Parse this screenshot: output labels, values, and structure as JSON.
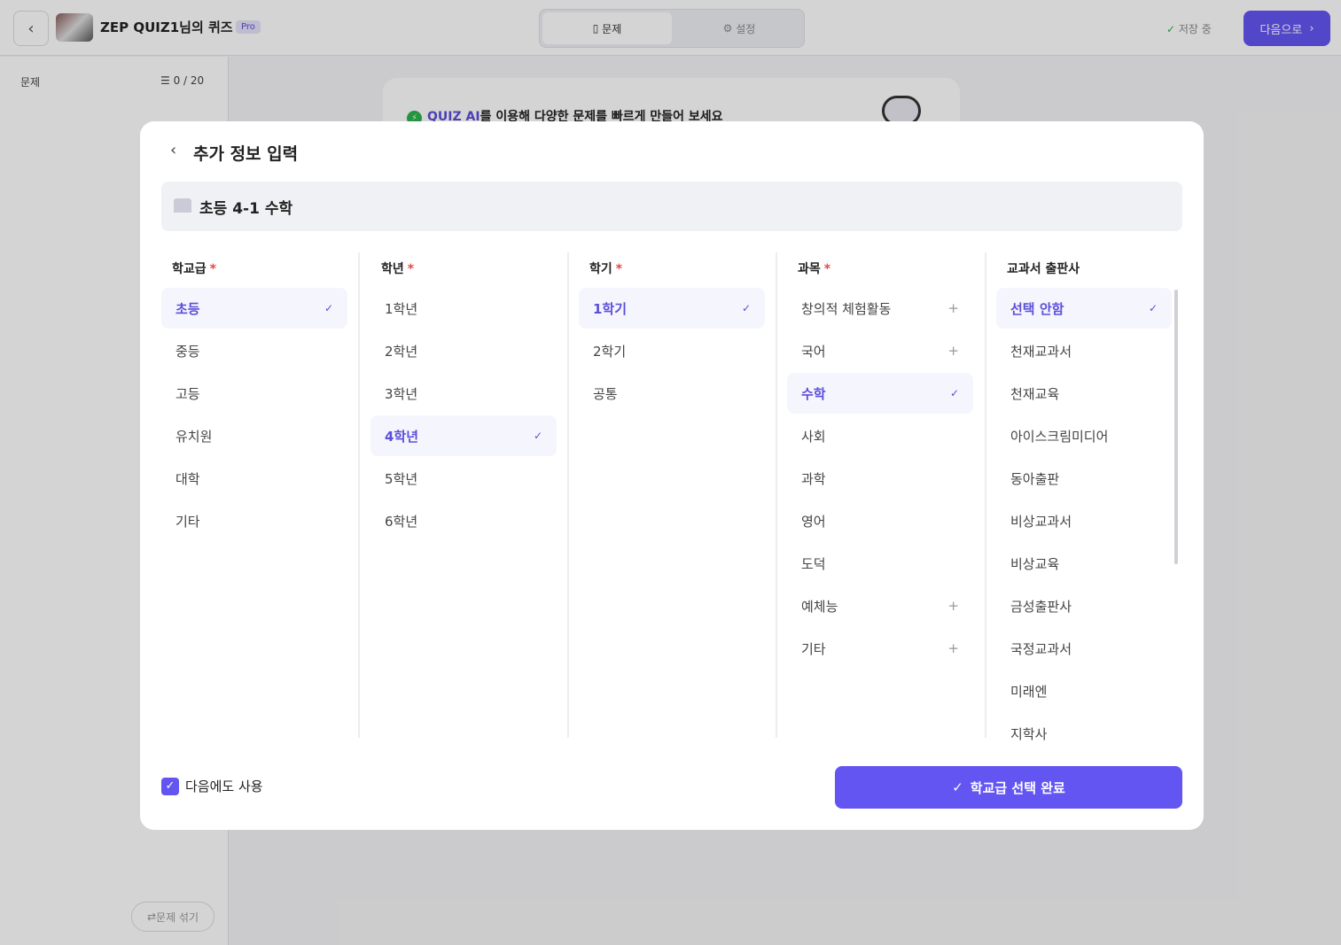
{
  "header": {
    "title": "ZEP QUIZ1님의 퀴즈",
    "badge": "Pro",
    "tabs": [
      {
        "label": "문제",
        "icon": "document-icon"
      },
      {
        "label": "설정",
        "icon": "gear-icon"
      }
    ],
    "status": "저장 중",
    "next": "다음으로"
  },
  "sidebar": {
    "label": "문제",
    "count": "0 / 20",
    "shuffle": "문제 섞기"
  },
  "ai_card": {
    "highlight": "QUIZ AI",
    "text": "를 이용해 다양한 문제를 빠르게 만들어 보세요"
  },
  "modal": {
    "title": "추가 정보 입력",
    "summary": "초등 4-1 수학",
    "remember_label": "다음에도 사용",
    "remember_checked": true,
    "confirm": "학교급 선택 완료",
    "columns": [
      {
        "header": "학교급",
        "required": true,
        "items": [
          {
            "label": "초등",
            "selected": true
          },
          {
            "label": "중등"
          },
          {
            "label": "고등"
          },
          {
            "label": "유치원"
          },
          {
            "label": "대학"
          },
          {
            "label": "기타"
          }
        ]
      },
      {
        "header": "학년",
        "required": true,
        "items": [
          {
            "label": "1학년"
          },
          {
            "label": "2학년"
          },
          {
            "label": "3학년"
          },
          {
            "label": "4학년",
            "selected": true
          },
          {
            "label": "5학년"
          },
          {
            "label": "6학년"
          }
        ]
      },
      {
        "header": "학기",
        "required": true,
        "items": [
          {
            "label": "1학기",
            "selected": true
          },
          {
            "label": "2학기"
          },
          {
            "label": "공통"
          }
        ]
      },
      {
        "header": "과목",
        "required": true,
        "items": [
          {
            "label": "창의적 체험활동",
            "expandable": true
          },
          {
            "label": "국어",
            "expandable": true
          },
          {
            "label": "수학",
            "selected": true
          },
          {
            "label": "사회"
          },
          {
            "label": "과학"
          },
          {
            "label": "영어"
          },
          {
            "label": "도덕"
          },
          {
            "label": "예체능",
            "expandable": true
          },
          {
            "label": "기타",
            "expandable": true
          }
        ]
      },
      {
        "header": "교과서 출판사",
        "required": false,
        "items": [
          {
            "label": "선택 안함",
            "selected": true
          },
          {
            "label": "천재교과서"
          },
          {
            "label": "천재교육"
          },
          {
            "label": "아이스크림미디어"
          },
          {
            "label": "동아출판"
          },
          {
            "label": "비상교과서"
          },
          {
            "label": "비상교육"
          },
          {
            "label": "금성출판사"
          },
          {
            "label": "국정교과서"
          },
          {
            "label": "미래엔"
          },
          {
            "label": "지학사"
          }
        ]
      }
    ]
  },
  "colors": {
    "accent": "#6355f2",
    "required": "#e54848",
    "success": "#2bb24c"
  }
}
